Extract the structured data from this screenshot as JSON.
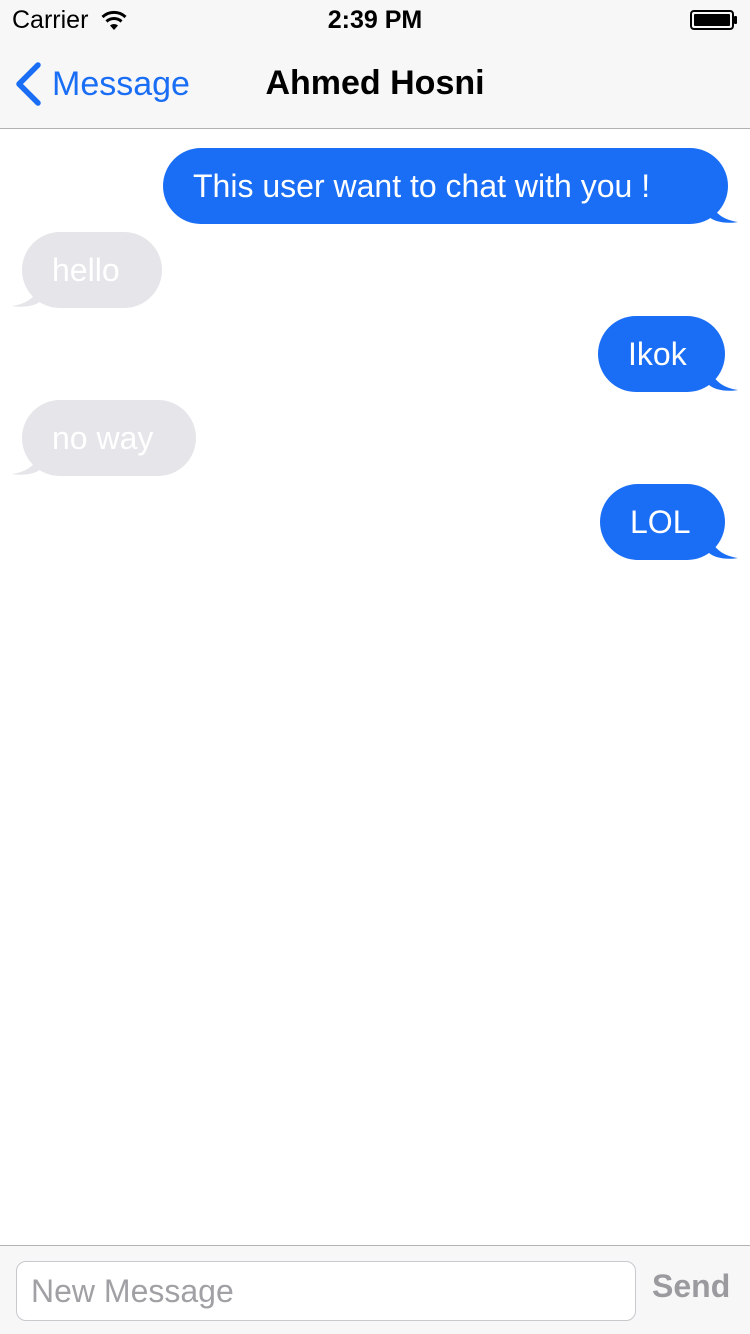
{
  "status_bar": {
    "carrier": "Carrier",
    "time": "2:39 PM",
    "wifi_icon": "wifi-icon",
    "battery_icon": "battery-icon"
  },
  "nav": {
    "back_label": "Message",
    "back_icon": "chevron-left-icon",
    "title": "Ahmed Hosni"
  },
  "messages": [
    {
      "text": "This user want to chat with you !",
      "direction": "outgoing"
    },
    {
      "text": "hello",
      "direction": "incoming"
    },
    {
      "text": "Ikok",
      "direction": "outgoing"
    },
    {
      "text": "no way",
      "direction": "incoming"
    },
    {
      "text": "LOL",
      "direction": "outgoing"
    }
  ],
  "composer": {
    "placeholder": "New Message",
    "value": "",
    "send_label": "Send"
  },
  "colors": {
    "accent": "#1a6ef5",
    "incoming_bubble": "#e5e5ea",
    "bar_background": "#f7f7f7",
    "send_disabled": "#9b9b9f"
  }
}
